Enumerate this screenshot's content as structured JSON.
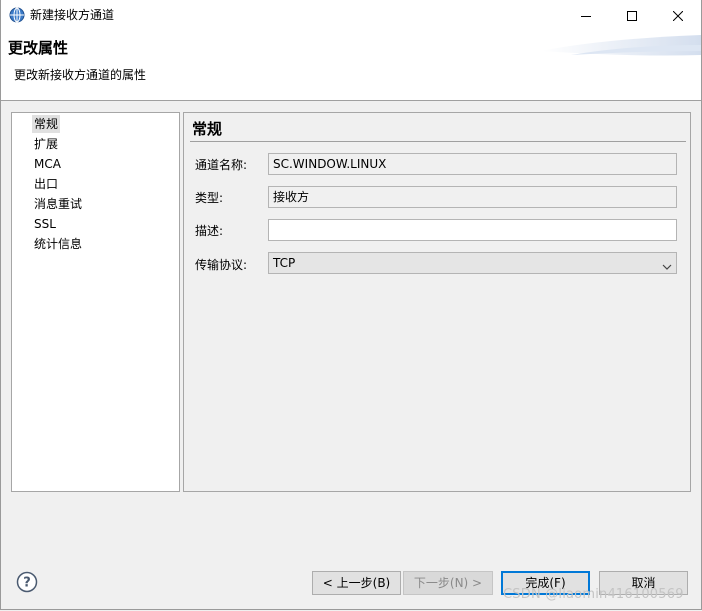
{
  "window": {
    "title": "新建接收方通道",
    "app_icon": "globe-icon",
    "controls": [
      "minimize-icon",
      "maximize-icon",
      "close-icon"
    ]
  },
  "header": {
    "title": "更改属性",
    "description": "更改新接收方通道的属性"
  },
  "tree": {
    "items": [
      {
        "label": "常规",
        "selected": true
      },
      {
        "label": "扩展"
      },
      {
        "label": "MCA"
      },
      {
        "label": "出口"
      },
      {
        "label": "消息重试"
      },
      {
        "label": "SSL"
      },
      {
        "label": "统计信息"
      }
    ]
  },
  "panel": {
    "title": "常规",
    "fields": [
      {
        "label": "通道名称:",
        "value": "SC.WINDOW.LINUX",
        "editable": false
      },
      {
        "label": "类型:",
        "value": "接收方",
        "editable": false
      },
      {
        "label": "描述:",
        "value": "",
        "editable": true
      },
      {
        "label": "传输协议:",
        "value": "TCP",
        "type": "select"
      }
    ]
  },
  "buttons": {
    "back": "< 上一步(B)",
    "next": "下一步(N) >",
    "finish": "完成(F)",
    "cancel": "取消"
  },
  "help_icon": "help-icon",
  "watermark": "CSDN @liaomin416100569",
  "colors": {
    "accent": "#0078d7",
    "background": "#f0f0f0"
  }
}
